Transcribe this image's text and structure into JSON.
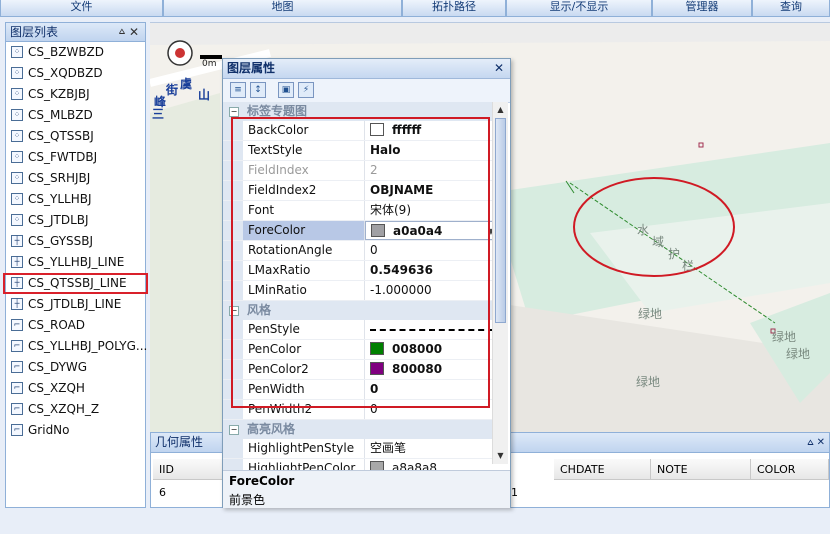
{
  "top_tabs": [
    "文件",
    "地图",
    "拓扑路径",
    "显示/不显示",
    "管理器",
    "查询"
  ],
  "layer_panel": {
    "title": "图层列表",
    "items": [
      {
        "label": "CS_BZWBZD",
        "icon": "point-layer-icon"
      },
      {
        "label": "CS_XQDBZD",
        "icon": "point-layer-icon"
      },
      {
        "label": "CS_KZBJBJ",
        "icon": "point-layer-icon"
      },
      {
        "label": "CS_MLBZD",
        "icon": "point-layer-icon"
      },
      {
        "label": "CS_QTSSBJ",
        "icon": "point-layer-icon"
      },
      {
        "label": "CS_FWTDBJ",
        "icon": "point-layer-icon"
      },
      {
        "label": "CS_SRHJBJ",
        "icon": "point-layer-icon"
      },
      {
        "label": "CS_YLLHBJ",
        "icon": "point-layer-icon"
      },
      {
        "label": "CS_JTDLBJ",
        "icon": "point-layer-icon"
      },
      {
        "label": "CS_GYSSBJ",
        "icon": "line-layer-icon"
      },
      {
        "label": "CS_YLLHBJ_LINE",
        "icon": "line-layer-icon"
      },
      {
        "label": "CS_QTSSBJ_LINE",
        "icon": "line-layer-icon",
        "selected": true
      },
      {
        "label": "CS_JTDLBJ_LINE",
        "icon": "line-layer-icon"
      },
      {
        "label": "CS_ROAD",
        "icon": "polyline-layer-icon"
      },
      {
        "label": "CS_YLLHBJ_POLYG...",
        "icon": "polyline-layer-icon"
      },
      {
        "label": "CS_DYWG",
        "icon": "polyline-layer-icon"
      },
      {
        "label": "CS_XZQH",
        "icon": "polyline-layer-icon"
      },
      {
        "label": "CS_XZQH_Z",
        "icon": "polyline-layer-icon"
      },
      {
        "label": "GridNo",
        "icon": "polyline-layer-icon"
      }
    ]
  },
  "map": {
    "scale_label": "0m",
    "labels": {
      "street_1": "街",
      "street_2": "虞",
      "street_3": "山",
      "street_4": "峰",
      "street_5": "三",
      "river_1": "水",
      "river_2": "域",
      "river_3": "护",
      "river_4": "栏",
      "green_1": "绿地",
      "green_2": "绿地",
      "green_3": "绿地",
      "green_4": "绿地"
    }
  },
  "properties_panel": {
    "title": "图层属性",
    "categories": {
      "label_theme": "标签专题图",
      "style": "风格",
      "highlight": "高亮风格"
    },
    "rows_label": [
      {
        "name": "BackColor",
        "value": "ffffff",
        "swatch": "#ffffff"
      },
      {
        "name": "TextStyle",
        "value": "Halo"
      },
      {
        "name": "FieldIndex",
        "value": "2",
        "disabled": true
      },
      {
        "name": "FieldIndex2",
        "value": "OBJNAME"
      },
      {
        "name": "Font",
        "value": "宋体(9)"
      },
      {
        "name": "ForeColor",
        "value": "a0a0a4",
        "swatch": "#a0a0a4",
        "highlighted": true
      },
      {
        "name": "RotationAngle",
        "value": "0"
      },
      {
        "name": "LMaxRatio",
        "value": "0.549636"
      },
      {
        "name": "LMinRatio",
        "value": "-1.000000"
      }
    ],
    "rows_style": [
      {
        "name": "PenStyle",
        "value": ""
      },
      {
        "name": "PenColor",
        "value": "008000",
        "swatch": "#008000"
      },
      {
        "name": "PenColor2",
        "value": "800080",
        "swatch": "#800080"
      },
      {
        "name": "PenWidth",
        "value": "0"
      },
      {
        "name": "PenWidth2",
        "value": "0"
      }
    ],
    "rows_highlight": [
      {
        "name": "HighlightPenStyle",
        "value": "空画笔"
      },
      {
        "name": "HighlightPenColor",
        "value": "a8a8a8",
        "swatch": "#a8a8a8"
      }
    ],
    "description": {
      "title": "ForeColor",
      "text": "前景色"
    }
  },
  "geometry_panel": {
    "title": "几何属性",
    "columns": [
      "IID",
      "CHDATE",
      "NOTE",
      "COLOR"
    ],
    "row": {
      "iid": "6",
      "partial": "1"
    }
  },
  "colors": {
    "highlight_red": "#d01a24",
    "header_blue": "#10306a"
  }
}
